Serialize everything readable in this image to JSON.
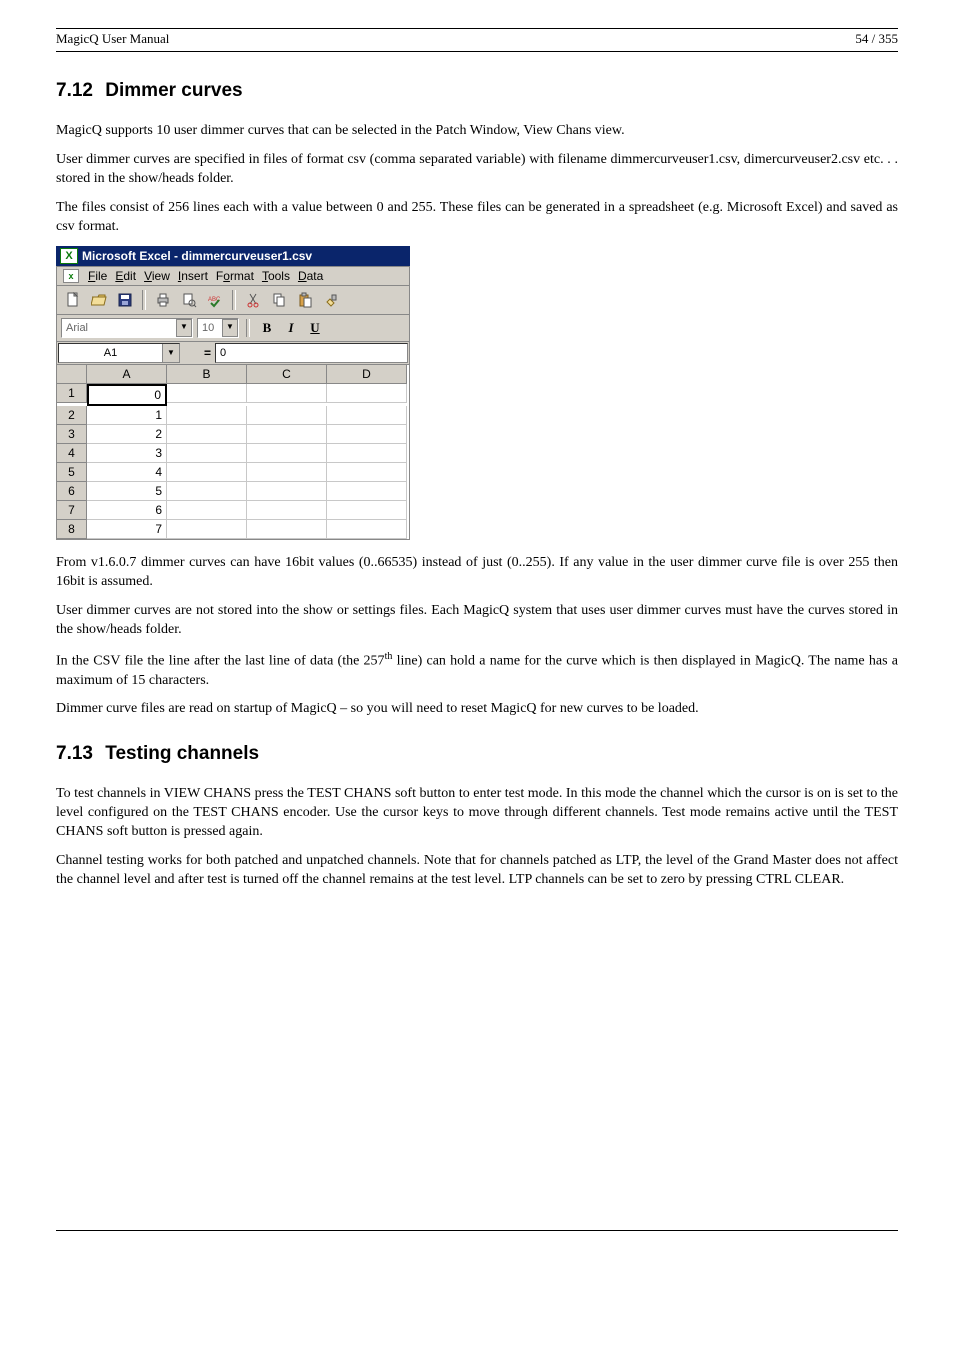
{
  "header": {
    "left": "MagicQ User Manual",
    "right": "54 / 355"
  },
  "section712": {
    "number": "7.12",
    "title": "Dimmer curves",
    "p1": "MagicQ supports 10 user dimmer curves that can be selected in the Patch Window, View Chans view.",
    "p2": "User dimmer curves are specified in files of format csv (comma separated variable) with filename dimmercurveuser1.csv, dimercurveuser2.csv etc. . .  stored in the show/heads folder.",
    "p3": "The files consist of 256 lines each with a value between 0 and 255. These files can be generated in a spreadsheet (e.g. Microsoft Excel) and saved as csv format.",
    "p4a": "From v1.6.0.7 dimmer curves can have 16bit values (0..66535) instead of just (0..255). If any value in the user dimmer curve file is over 255 then 16bit is assumed.",
    "p4b": "User dimmer curves are not stored into the show or settings files. Each MagicQ system that uses user dimmer curves must have the curves stored in the show/heads folder.",
    "p4c_pre": "In the CSV file the line after the last line of data (the 257",
    "p4c_sup": "th",
    "p4c_post": " line) can hold a name for the curve which is then displayed in MagicQ. The name has a maximum of 15 characters.",
    "p4d": "Dimmer curve files are read on startup of MagicQ – so you will need to reset MagicQ for new curves to be loaded."
  },
  "section713": {
    "number": "7.13",
    "title": "Testing channels",
    "p1": "To test channels in VIEW CHANS press the TEST CHANS soft button to enter test mode. In this mode the channel which the cursor is on is set to the level configured on the TEST CHANS encoder. Use the cursor keys to move through different channels. Test mode remains active until the TEST CHANS soft button is pressed again.",
    "p2": "Channel testing works for both patched and unpatched channels. Note that for channels patched as LTP, the level of the Grand Master does not affect the channel level and after test is turned off the channel remains at the test level. LTP channels can be set to zero by pressing CTRL CLEAR."
  },
  "excel": {
    "title": "Microsoft Excel - dimmercurveuser1.csv",
    "menu": {
      "file": "File",
      "edit": "Edit",
      "view": "View",
      "insert": "Insert",
      "format": "Format",
      "tools": "Tools",
      "data": "Data"
    },
    "font_name": "Arial",
    "font_size": "10",
    "bold": "B",
    "italic": "I",
    "underline": "U",
    "name_box": "A1",
    "formula_value": "0",
    "columns": [
      "A",
      "B",
      "C",
      "D"
    ],
    "rows": [
      {
        "n": "1",
        "a": "0"
      },
      {
        "n": "2",
        "a": "1"
      },
      {
        "n": "3",
        "a": "2"
      },
      {
        "n": "4",
        "a": "3"
      },
      {
        "n": "5",
        "a": "4"
      },
      {
        "n": "6",
        "a": "5"
      },
      {
        "n": "7",
        "a": "6"
      },
      {
        "n": "8",
        "a": "7"
      }
    ]
  }
}
